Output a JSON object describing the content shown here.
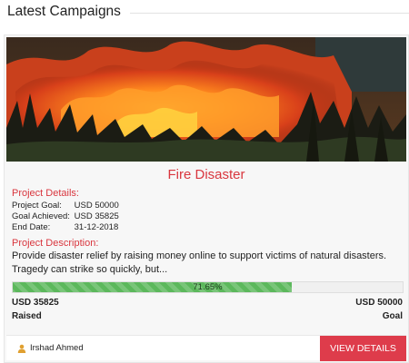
{
  "section": {
    "title": "Latest Campaigns"
  },
  "campaign": {
    "title": "Fire Disaster",
    "details_heading": "Project Details:",
    "details": [
      {
        "label": "Project Goal:",
        "value": "USD 50000"
      },
      {
        "label": "Goal Achieved:",
        "value": "USD 35825"
      },
      {
        "label": "End Date:",
        "value": "31-12-2018"
      }
    ],
    "description_heading": "Project Description:",
    "description": "Provide disaster relief by raising money online to support victims of natural disasters. Tragedy can strike so quickly, but...",
    "progress": {
      "percent": 71.65,
      "label": "71.65%"
    },
    "raised_amount": "USD 35825",
    "raised_label": "Raised",
    "goal_amount": "USD 50000",
    "goal_label": "Goal",
    "author": "Irshad Ahmed",
    "author_icon": "user-icon",
    "button_label": "VIEW DETAILS"
  },
  "colors": {
    "accent_red": "#d9363e",
    "button_red": "#de3c4b",
    "progress_green": "#5cb85c",
    "user_icon": "#e0a030"
  }
}
